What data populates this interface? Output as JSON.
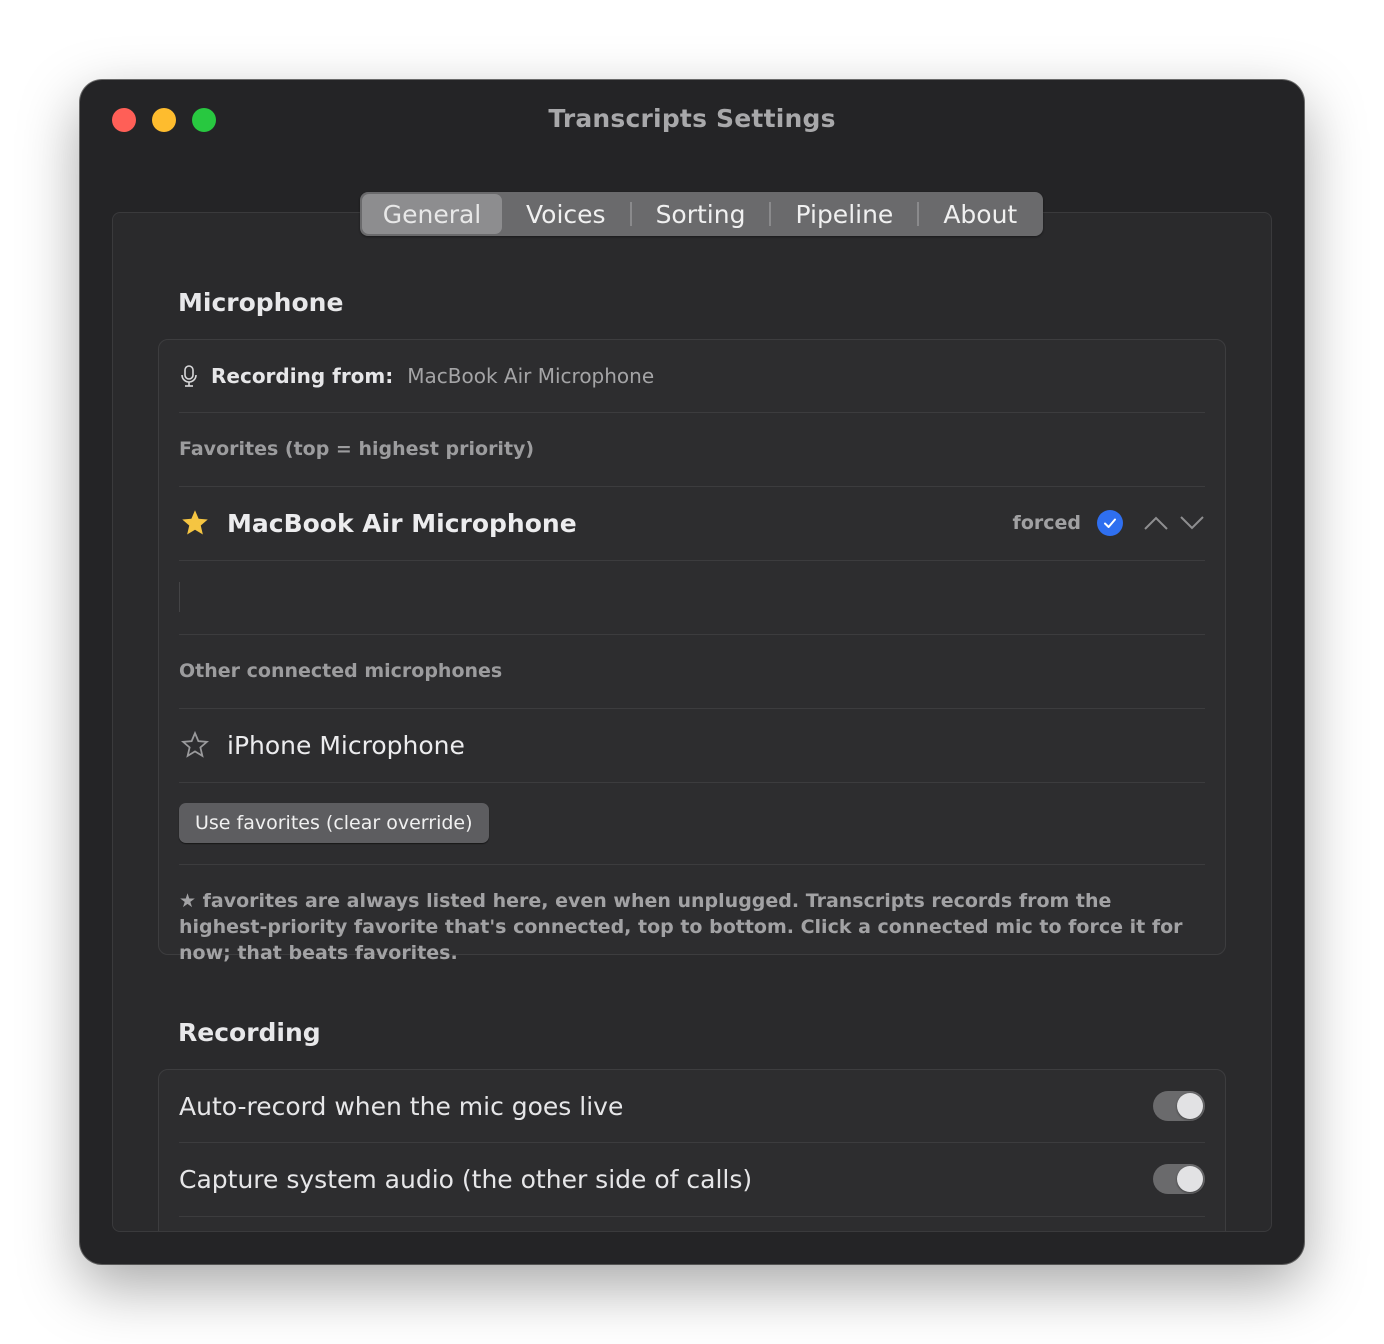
{
  "window": {
    "title": "Transcripts Settings"
  },
  "tabs": [
    {
      "label": "General",
      "active": true
    },
    {
      "label": "Voices",
      "active": false
    },
    {
      "label": "Sorting",
      "active": false
    },
    {
      "label": "Pipeline",
      "active": false
    },
    {
      "label": "About",
      "active": false
    }
  ],
  "microphone": {
    "section_title": "Microphone",
    "recording_from_label": "Recording from:",
    "recording_from_value": "MacBook Air Microphone",
    "favorites_heading": "Favorites (top = highest priority)",
    "favorites": [
      {
        "name": "MacBook Air Microphone",
        "status": "forced",
        "icon": "star-filled-icon"
      }
    ],
    "other_heading": "Other connected microphones",
    "others": [
      {
        "name": "iPhone Microphone",
        "icon": "star-outline-icon"
      }
    ],
    "clear_button_label": "Use favorites (clear override)",
    "footnote": "★ favorites are always listed here, even when unplugged. Transcripts records from the highest-priority favorite that's connected, top to bottom. Click a connected mic to force it for now; that beats favorites."
  },
  "recording": {
    "section_title": "Recording",
    "toggles": [
      {
        "label": "Auto-record when the mic goes live",
        "on": true
      },
      {
        "label": "Capture system audio (the other side of calls)",
        "on": true
      }
    ]
  },
  "colors": {
    "accent": "#2f6ff0",
    "star": "#f5c542",
    "window_bg": "#242426"
  }
}
